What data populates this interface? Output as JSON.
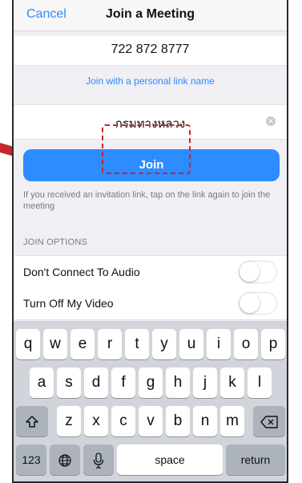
{
  "nav": {
    "cancel_label": "Cancel",
    "title": "Join a Meeting"
  },
  "meeting": {
    "id_value": "722 872 8777"
  },
  "link": {
    "label": "Join with a personal link name"
  },
  "name_field": {
    "value": "กรมทางหลวง",
    "clear_icon": "clear-icon"
  },
  "join": {
    "label": "Join"
  },
  "hint": {
    "text": "If you received an invitation link, tap on the link again to join the meeting"
  },
  "options": {
    "section_label": "JOIN OPTIONS",
    "audio_label": "Don't Connect To Audio",
    "video_label": "Turn Off My Video",
    "audio_on": false,
    "video_on": false
  },
  "keyboard": {
    "row1": [
      "q",
      "w",
      "e",
      "r",
      "t",
      "y",
      "u",
      "i",
      "o",
      "p"
    ],
    "row2": [
      "a",
      "s",
      "d",
      "f",
      "g",
      "h",
      "j",
      "k",
      "l"
    ],
    "row3": [
      "z",
      "x",
      "c",
      "v",
      "b",
      "n",
      "m"
    ],
    "numbers_label": "123",
    "space_label": "space",
    "return_label": "return"
  },
  "colors": {
    "accent": "#2d8cff",
    "annotation": "#c6252a"
  }
}
